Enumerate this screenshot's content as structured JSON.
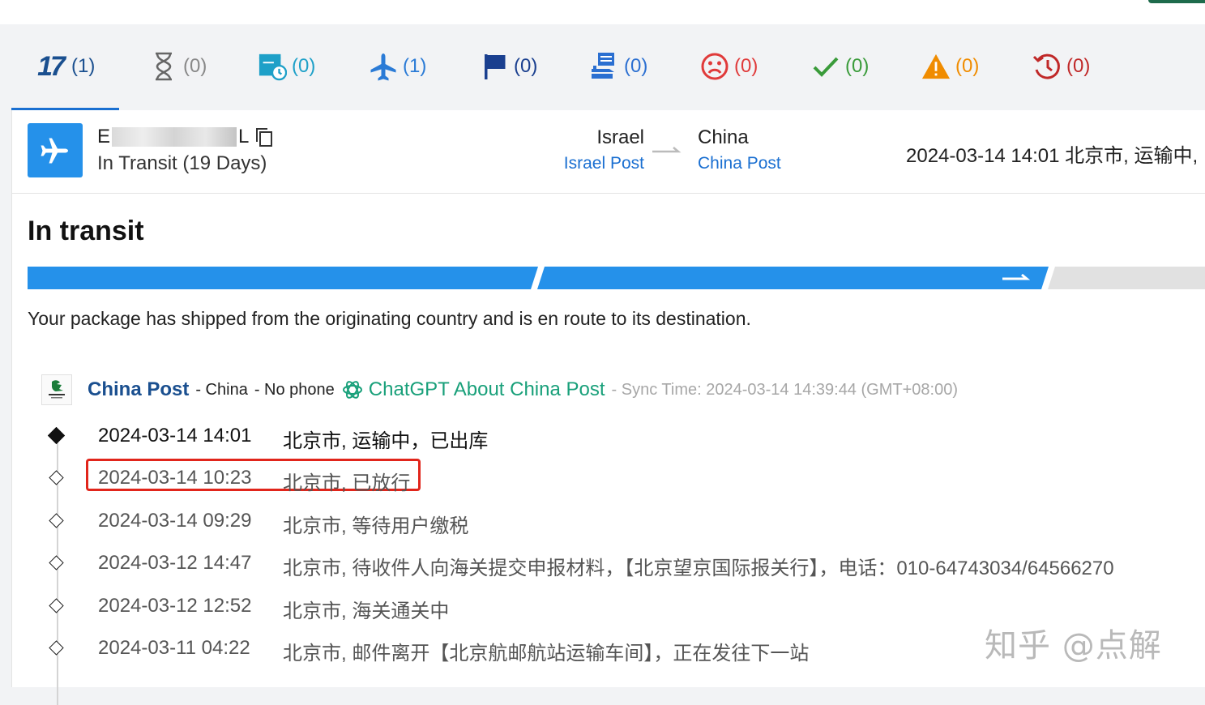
{
  "tabs": [
    {
      "name": "all",
      "icon": "17track-logo-icon",
      "logo_text": "17",
      "count": "(1)",
      "color": "#1a4f8f"
    },
    {
      "name": "not-found",
      "icon": "hourglass-icon",
      "count": "(0)",
      "color": "#888888"
    },
    {
      "name": "info-received",
      "icon": "package-clock-icon",
      "count": "(0)",
      "color": "#1ea0c8"
    },
    {
      "name": "in-transit",
      "icon": "airplane-icon",
      "count": "(1)",
      "color": "#2b7bd6"
    },
    {
      "name": "pick-up",
      "icon": "flag-icon",
      "count": "(0)",
      "color": "#1a3f8f"
    },
    {
      "name": "out-for-delivery",
      "icon": "delivery-icon",
      "count": "(0)",
      "color": "#2b6fd1"
    },
    {
      "name": "undelivered",
      "icon": "sad-face-icon",
      "count": "(0)",
      "color": "#e03a3a"
    },
    {
      "name": "delivered",
      "icon": "check-icon",
      "count": "(0)",
      "color": "#3a9b3a"
    },
    {
      "name": "alert",
      "icon": "warning-icon",
      "count": "(0)",
      "color": "#f08c00"
    },
    {
      "name": "expired",
      "icon": "history-icon",
      "count": "(0)",
      "color": "#c02828"
    }
  ],
  "summary": {
    "tracking_start": "E",
    "tracking_end": "L",
    "status": "In Transit (19 Days)",
    "origin_country": "Israel",
    "origin_carrier": "Israel Post",
    "dest_country": "China",
    "dest_carrier": "China Post",
    "latest_event": "2024-03-14 14:01 北京市, 运输中,"
  },
  "status_title": "In transit",
  "status_description": "Your package has shipped from the originating country and is en route to its destination.",
  "progress": {
    "completed_segments": 2,
    "total_segments": 3
  },
  "carrier": {
    "name": "China Post",
    "country": "- China",
    "phone": "- No phone",
    "chatgpt": "ChatGPT About China Post",
    "sync": "- Sync Time: 2024-03-14 14:39:44 (GMT+08:00)"
  },
  "events": [
    {
      "time": "2024-03-14 14:01",
      "desc": "北京市, 运输中，已出库"
    },
    {
      "time": "2024-03-14 10:23",
      "desc": "北京市, 已放行"
    },
    {
      "time": "2024-03-14 09:29",
      "desc": "北京市, 等待用户缴税"
    },
    {
      "time": "2024-03-12 14:47",
      "desc": "北京市, 待收件人向海关提交申报材料，【北京望京国际报关行】，电话：010-64743034/64566270"
    },
    {
      "time": "2024-03-12 12:52",
      "desc": "北京市, 海关通关中"
    },
    {
      "time": "2024-03-11 04:22",
      "desc": "北京市, 邮件离开【北京航邮航站运输车间】，正在发往下一站"
    }
  ],
  "watermark": "知乎 @点解",
  "colors": {
    "accent": "#2591ea",
    "link": "#1a6fd1",
    "highlight": "#e1251b",
    "chatgpt": "#19a07a"
  }
}
